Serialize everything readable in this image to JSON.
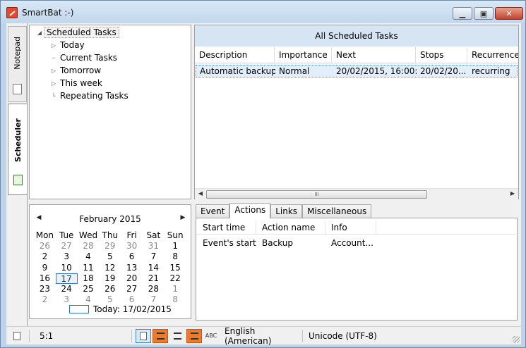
{
  "window": {
    "title": "SmartBat :-)"
  },
  "side_tabs": [
    {
      "label": "Notepad"
    },
    {
      "label": "Scheduler"
    }
  ],
  "tree": {
    "root": "Scheduled Tasks",
    "items": [
      "Today",
      "Current Tasks",
      "Tomorrow",
      "This week",
      "Repeating Tasks"
    ]
  },
  "calendar": {
    "month_label": "February 2015",
    "weekdays": [
      "Mon",
      "Tue",
      "Wed",
      "Thu",
      "Fri",
      "Sat",
      "Sun"
    ],
    "weeks": [
      [
        "26",
        "27",
        "28",
        "29",
        "30",
        "31",
        "1"
      ],
      [
        "2",
        "3",
        "4",
        "5",
        "6",
        "7",
        "8"
      ],
      [
        "9",
        "10",
        "11",
        "12",
        "13",
        "14",
        "15"
      ],
      [
        "16",
        "17",
        "18",
        "19",
        "20",
        "21",
        "22"
      ],
      [
        "23",
        "24",
        "25",
        "26",
        "27",
        "28",
        "1"
      ],
      [
        "2",
        "3",
        "4",
        "5",
        "6",
        "7",
        "8"
      ]
    ],
    "selected_day": "17",
    "today_label": "Today: 17/02/2015"
  },
  "tasks": {
    "title": "All Scheduled Tasks",
    "columns": [
      "Description",
      "Importance",
      "Next",
      "Stops",
      "Recurrence"
    ],
    "rows": [
      [
        "Automatic backup",
        "Normal",
        "20/02/2015, 16:00:...",
        "20/02/20...",
        "recurring"
      ]
    ],
    "scroll_thumb_glyph": "III"
  },
  "detail": {
    "tabs": [
      "Event",
      "Actions",
      "Links",
      "Miscellaneous"
    ],
    "active_tab": "Actions",
    "columns": [
      "Start time",
      "Action name",
      "Info"
    ],
    "rows": [
      [
        "Event's start",
        "Backup",
        "Account..."
      ]
    ]
  },
  "statusbar": {
    "position": "5:1",
    "language": "English (American)",
    "encoding": "Unicode (UTF-8)",
    "spell_label": "ABC"
  }
}
